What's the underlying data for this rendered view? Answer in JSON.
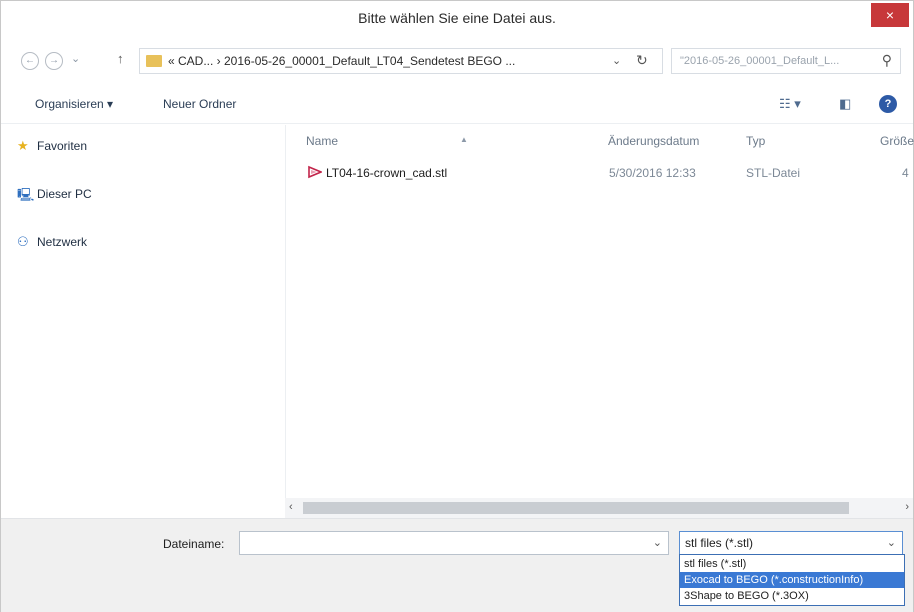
{
  "window": {
    "title": "Bitte wählen Sie eine Datei aus.",
    "close_label": "×"
  },
  "nav": {
    "back_icon": "←",
    "forward_icon": "→",
    "recent_icon": "⌄",
    "up_icon": "↑",
    "address": "« CAD... › 2016-05-26_00001_Default_LT04_Sendetest BEGO ...",
    "address_dropdown_icon": "⌄",
    "refresh_icon": "↻",
    "search_placeholder": "\"2016-05-26_00001_Default_L...",
    "search_icon": "⚲"
  },
  "toolbar": {
    "organize_label": "Organisieren ▾",
    "new_folder_label": "Neuer Ordner",
    "view_icon": "☷ ▾",
    "pane_icon": "◧",
    "help_icon": "?"
  },
  "sidebar": {
    "items": [
      {
        "label": "Favoriten",
        "icon": "star-icon",
        "glyph": "★"
      },
      {
        "label": "Dieser PC",
        "icon": "computer-icon",
        "glyph": "🖳"
      },
      {
        "label": "Netzwerk",
        "icon": "network-icon",
        "glyph": "⚇"
      }
    ]
  },
  "columns": {
    "name": "Name",
    "date": "Änderungsdatum",
    "type": "Typ",
    "size": "Größe"
  },
  "files": [
    {
      "name": "LT04-16-crown_cad.stl",
      "date": "5/30/2016 12:33",
      "type": "STL-Datei",
      "size": "4"
    }
  ],
  "scroll": {
    "left_arrow": "‹",
    "right_arrow": "›"
  },
  "bottom": {
    "filename_label": "Dateiname:",
    "filename_value": "",
    "filename_chevron": "⌄",
    "filter_value": "stl files (*.stl)",
    "filter_chevron": "⌄",
    "filter_options": [
      "stl files (*.stl)",
      "Exocad to BEGO (*.constructionInfo)",
      "3Shape to BEGO (*.3OX)"
    ],
    "selected_index": 1
  },
  "colors": {
    "close_button": "#c7383a",
    "selection": "#3a79d4",
    "folder": "#e8c15a",
    "stl_icon": "#c2244a"
  }
}
